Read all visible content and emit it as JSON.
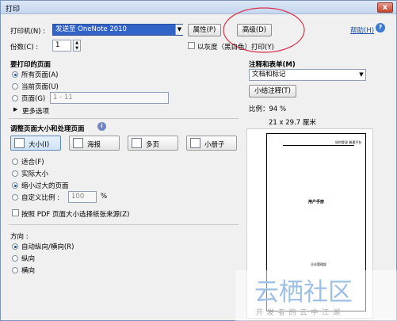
{
  "window": {
    "title": "打印",
    "close_glyph": "x"
  },
  "printer": {
    "label": "打印机(N) :",
    "value": "发送至 OneNote 2010",
    "properties_button": "属性(P)",
    "advanced_button": "高级(D)",
    "help_link": "帮助(H)",
    "help_icon": "?"
  },
  "copies": {
    "label": "份数(C) :",
    "value": "1"
  },
  "grayscale": {
    "label": "以灰度（黑白色）打印(Y)",
    "checked": false
  },
  "pages_to_print": {
    "title": "要打印的页面",
    "options": [
      "所有页面(A)",
      "当前页面(U)",
      "页面(G)"
    ],
    "selected": 0,
    "range_placeholder": "1 - 11",
    "more_options": "更多选项"
  },
  "page_sizing": {
    "title": "调整页面大小和处理页面",
    "info_icon": "i",
    "modes": [
      {
        "label": "大小(I)",
        "icon": "size-icon"
      },
      {
        "label": "海报",
        "icon": "poster-icon"
      },
      {
        "label": "多页",
        "icon": "multiple-pages-icon"
      },
      {
        "label": "小册子",
        "icon": "booklet-icon"
      }
    ],
    "selected_mode": 0,
    "fit_options": [
      "适合(F)",
      "实际大小",
      "缩小过大的页面",
      "自定义比例 :"
    ],
    "selected_fit": 2,
    "custom_scale_value": "100",
    "percent_sign": "%",
    "paper_source_label": "按照 PDF 页面大小选择纸张来源(Z)"
  },
  "orientation": {
    "title": "方向 :",
    "options": [
      "自动纵向/横向(R)",
      "纵向",
      "横向"
    ],
    "selected": 0
  },
  "comments": {
    "title": "注释和表单(M)",
    "dropdown_value": "文档和标记",
    "summarize_button": "小结注释(T)"
  },
  "preview": {
    "scale_text": "比例：94 %",
    "size_text": "21 x 29.7 厘米",
    "page_header_text": "如何登录 普通平台",
    "page_title_text": "用户手册",
    "page_footer_text": "企业管理部"
  },
  "watermark": {
    "brand": "云栖社区",
    "tagline": "开 发 者 的 云 中 江 湖"
  }
}
